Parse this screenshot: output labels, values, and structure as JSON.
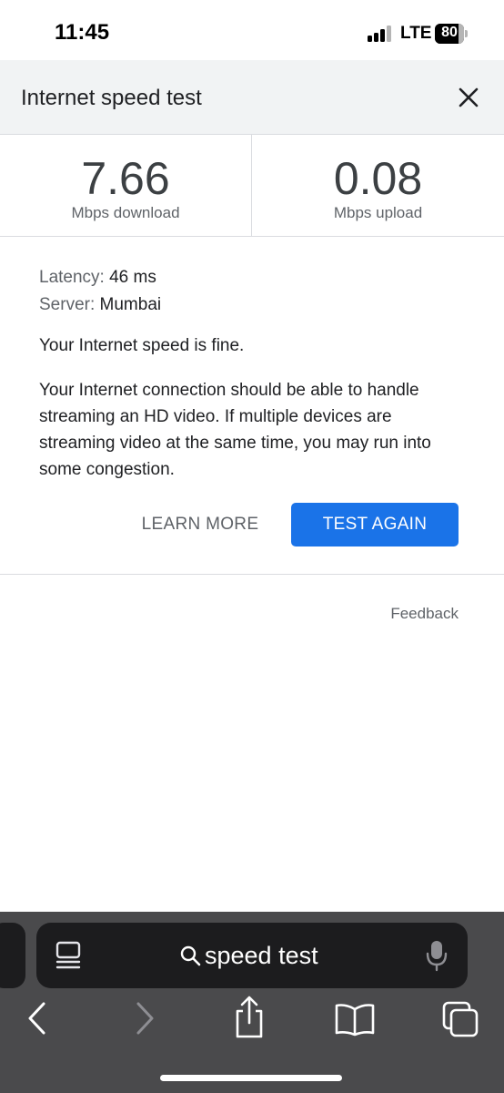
{
  "status_bar": {
    "time": "11:45",
    "network": "LTE",
    "battery_percent": "80",
    "battery_level": 0.8
  },
  "card": {
    "title": "Internet speed test",
    "download": {
      "value": "7.66",
      "label": "Mbps download"
    },
    "upload": {
      "value": "0.08",
      "label": "Mbps upload"
    },
    "latency_label": "Latency:",
    "latency_value": "46 ms",
    "server_label": "Server:",
    "server_value": "Mumbai",
    "summary": "Your Internet speed is fine.",
    "explanation": "Your Internet connection should be able to handle streaming an HD video. If multiple devices are streaming video at the same time, you may run into some congestion.",
    "learn_more_label": "LEARN MORE",
    "test_again_label": "TEST AGAIN",
    "feedback_label": "Feedback"
  },
  "browser": {
    "search_query": "speed test",
    "icons": [
      "tab-overview-icon",
      "search-icon",
      "microphone-icon",
      "back-icon",
      "forward-icon",
      "share-icon",
      "bookmarks-icon",
      "tabs-icon"
    ]
  },
  "colors": {
    "accent": "#1a73e8",
    "header_bg": "#f1f3f4",
    "toolbar_bg": "#4a4a4c",
    "pill_bg": "#1c1c1e"
  }
}
